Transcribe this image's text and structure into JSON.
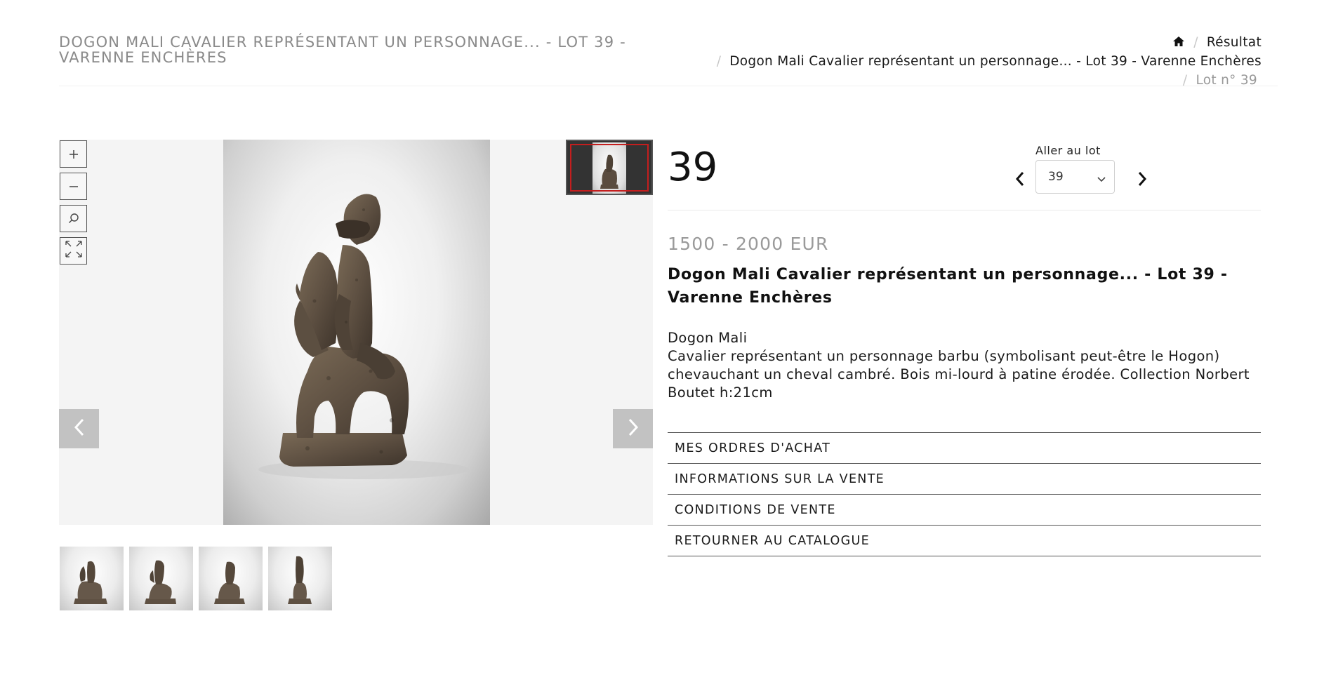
{
  "page": {
    "title": "DOGON MALI CAVALIER REPRÉSENTANT UN PERSONNAGE... - LOT 39 - VARENNE ENCHÈRES"
  },
  "breadcrumb": {
    "home_icon": "home-icon",
    "result_label": "Résultat",
    "item_label": "Dogon Mali Cavalier représentant un personnage... - Lot 39 - Varenne Enchères",
    "lot_label": "Lot n° 39"
  },
  "viewer": {
    "zoom_in_icon": "plus-icon",
    "zoom_out_icon": "minus-icon",
    "home_zoom_icon": "magnifier-icon",
    "fullscreen_icon": "expand-arrows-icon",
    "prev_icon": "chevron-left-icon",
    "next_icon": "chevron-right-icon"
  },
  "lot": {
    "number": "39",
    "goto_label": "Aller au lot",
    "goto_selected": "39",
    "estimate": "1500 - 2000 EUR",
    "title": "Dogon Mali Cavalier représentant un personnage... - Lot 39 - Varenne Enchères",
    "description_line1": "Dogon Mali",
    "description_line2": "Cavalier représentant un personnage barbu (symbolisant peut-être le Hogon) chevauchant un cheval cambré. Bois mi-lourd à patine érodée. Collection Norbert Boutet h:21cm"
  },
  "menu": [
    {
      "label": "MES ORDRES D'ACHAT"
    },
    {
      "label": "INFORMATIONS SUR LA VENTE"
    },
    {
      "label": "CONDITIONS DE VENTE"
    },
    {
      "label": "RETOURNER AU CATALOGUE"
    }
  ],
  "colors": {
    "accent_frame": "#c41e1e",
    "muted_text": "#8a8a8a",
    "arrow_button": "#c2c2c2"
  }
}
